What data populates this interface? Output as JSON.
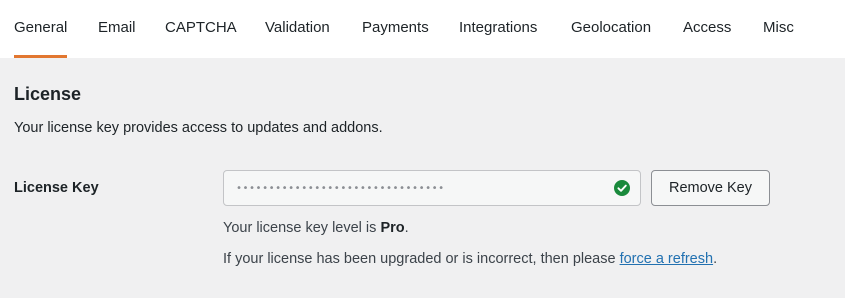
{
  "tabs": [
    {
      "label": "General",
      "active": true
    },
    {
      "label": "Email",
      "active": false
    },
    {
      "label": "CAPTCHA",
      "active": false
    },
    {
      "label": "Validation",
      "active": false
    },
    {
      "label": "Payments",
      "active": false
    },
    {
      "label": "Integrations",
      "active": false
    },
    {
      "label": "Geolocation",
      "active": false
    },
    {
      "label": "Access",
      "active": false
    },
    {
      "label": "Misc",
      "active": false
    }
  ],
  "license": {
    "title": "License",
    "description": "Your license key provides access to updates and addons.",
    "key_label": "License Key",
    "key_value": "••••••••••••••••••••••••••••••••",
    "key_status_icon": "check-circle-icon",
    "remove_button_label": "Remove Key",
    "level_prefix": "Your license key level is ",
    "level_value": "Pro",
    "level_suffix": ".",
    "refresh_prefix": "If your license has been upgraded or is incorrect, then please ",
    "refresh_link_text": "force a refresh",
    "refresh_suffix": "."
  },
  "colors": {
    "active_tab_accent": "#e27730",
    "valid_check": "#1a8a3c",
    "link": "#2271b1"
  }
}
